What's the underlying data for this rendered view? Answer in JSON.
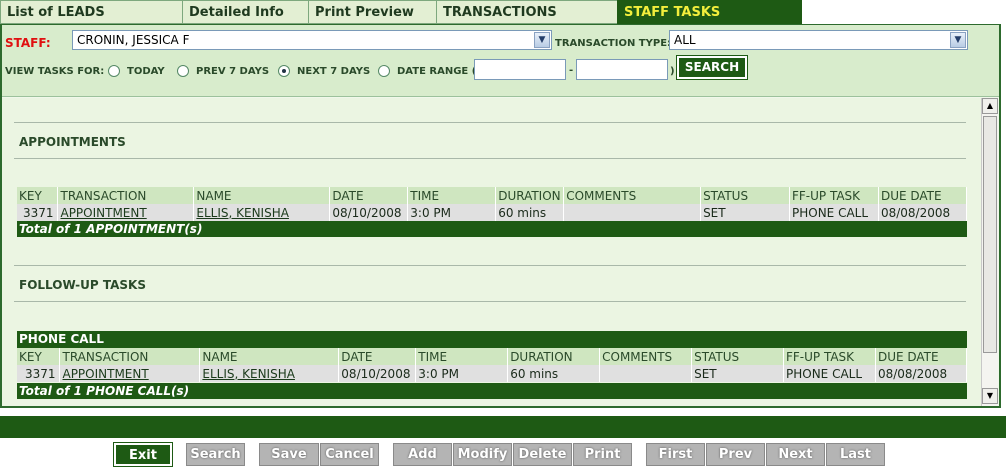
{
  "tabs": [
    {
      "label": "List of LEADS",
      "active": false
    },
    {
      "label": "Detailed Info",
      "active": false
    },
    {
      "label": "Print Preview",
      "active": false
    },
    {
      "label": "TRANSACTIONS",
      "active": false
    },
    {
      "label": "STAFF TASKS",
      "active": true
    }
  ],
  "filter": {
    "staff_label": "STAFF:",
    "staff_value": "CRONIN, JESSICA F",
    "transaction_type_label": "TRANSACTION TYPE:",
    "transaction_type_value": "ALL",
    "view_tasks_label": "VIEW TASKS FOR:",
    "options": [
      "TODAY",
      "PREV 7 DAYS",
      "NEXT 7 DAYS",
      "DATE RANGE ("
    ],
    "selected_option": "NEXT 7 DAYS",
    "range_from": "",
    "range_dash": "-",
    "range_close": ")",
    "search_label": "SEARCH"
  },
  "appointments": {
    "title": "APPOINTMENTS",
    "columns": [
      "KEY",
      "TRANSACTION",
      "NAME",
      "DATE",
      "TIME",
      "DURATION",
      "COMMENTS",
      "STATUS",
      "FF-UP TASK",
      "DUE DATE"
    ],
    "rows": [
      {
        "key": "3371",
        "transaction": "APPOINTMENT",
        "name": "ELLIS, KENISHA",
        "date": "08/10/2008",
        "time": "3:0 PM",
        "duration": "60 mins",
        "comments": "",
        "status": "SET",
        "ffup": "PHONE CALL",
        "due": "08/08/2008"
      }
    ],
    "total": "Total of 1 APPOINTMENT(s)"
  },
  "followups": {
    "title": "FOLLOW-UP TASKS",
    "group": "PHONE CALL",
    "columns": [
      "KEY",
      "TRANSACTION",
      "NAME",
      "DATE",
      "TIME",
      "DURATION",
      "COMMENTS",
      "STATUS",
      "FF-UP TASK",
      "DUE DATE"
    ],
    "rows": [
      {
        "key": "3371",
        "transaction": "APPOINTMENT",
        "name": "ELLIS, KENISHA",
        "date": "08/10/2008",
        "time": "3:0 PM",
        "duration": "60 mins",
        "comments": "",
        "status": "SET",
        "ffup": "PHONE CALL",
        "due": "08/08/2008"
      }
    ],
    "total": "Total of 1 PHONE CALL(s)"
  },
  "scrollbar": {
    "up_icon": "▲",
    "down_icon": "▼"
  },
  "toolbar": {
    "exit": "Exit",
    "search": "Search",
    "save": "Save",
    "cancel": "Cancel",
    "add": "Add",
    "modify": "Modify",
    "delete": "Delete",
    "print": "Print",
    "first": "First",
    "prev": "Prev",
    "next": "Next",
    "last": "Last"
  },
  "colors": {
    "brand_green": "#1e5a14",
    "active_tab_text": "#f2ee3c",
    "staff_label": "#e01010"
  }
}
